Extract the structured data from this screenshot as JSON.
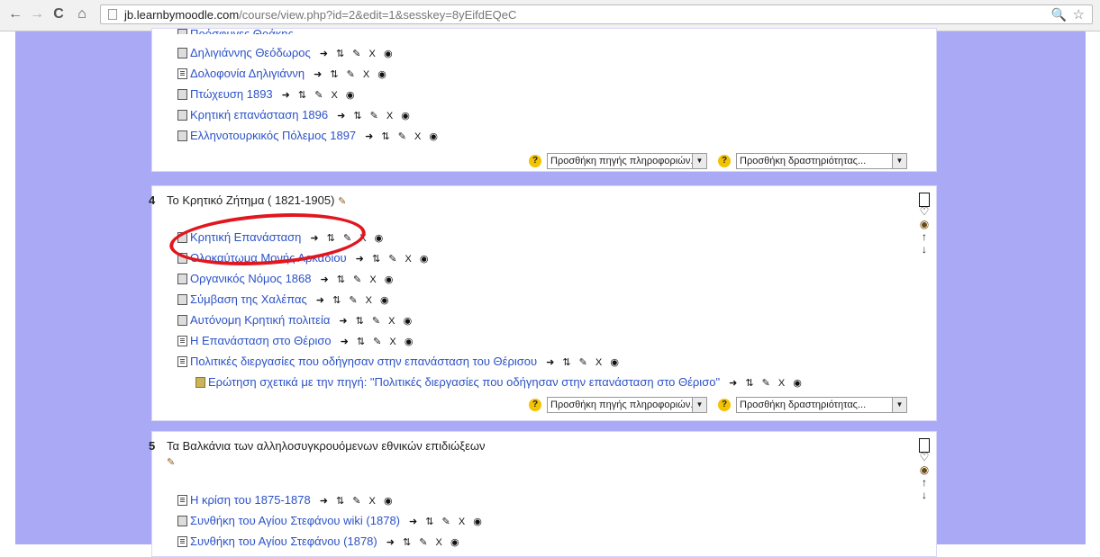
{
  "browser": {
    "back": "←",
    "forward": "→",
    "reload": "C",
    "home": "⌂",
    "url_host": "jb.learnbymoodle.com",
    "url_path": "/course/view.php?id=2&edit=1&sesskey=8yEifdEQeC",
    "zoom": "🔍",
    "star": "☆"
  },
  "sections": [
    {
      "number": "",
      "title": "",
      "items": [
        {
          "label": "Δηλιγιάννης Θεόδωρος",
          "type": "link"
        },
        {
          "label": "Δολοφονία Δηλιγιάννη",
          "type": "res"
        },
        {
          "label": "Πτώχευση 1893",
          "type": "link"
        },
        {
          "label": "Κρητική επανάσταση 1896",
          "type": "link"
        },
        {
          "label": "Ελληνοτουρκικός Πόλεμος 1897",
          "type": "link"
        }
      ],
      "add_resource": "Προσθήκη πηγής πληροφοριών...",
      "add_activity": "Προσθήκη δραστηριότητας..."
    },
    {
      "number": "4",
      "title": "Το Κρητικό Ζήτημα ( 1821-1905)",
      "items": [
        {
          "label": "Κρητική Επανάσταση",
          "type": "link"
        },
        {
          "label": "Ολοκαύτωμα Μονής Αρκαδίου",
          "type": "link"
        },
        {
          "label": "Οργανικός Νόμος 1868",
          "type": "link"
        },
        {
          "label": "Σύμβαση της Χαλέπας",
          "type": "link"
        },
        {
          "label": "Αυτόνομη Κρητική πολιτεία",
          "type": "link"
        },
        {
          "label": "Η Επανάσταση στο Θέρισο",
          "type": "res"
        },
        {
          "label": "Πολιτικές διεργασίες που οδήγησαν στην επανάσταση του Θέρισου",
          "type": "res"
        },
        {
          "label": "Ερώτηση σχετικά με την πηγή: \"Πολιτικές διεργασίες που οδήγησαν στην επανάσταση στο Θέρισο\"",
          "type": "quiz"
        }
      ],
      "add_resource": "Προσθήκη πηγής πληροφοριών...",
      "add_activity": "Προσθήκη δραστηριότητας..."
    },
    {
      "number": "5",
      "title": "Τα Βαλκάνια των αλληλοσυγκρουόμενων εθνικών επιδιώξεων",
      "items": [
        {
          "label": "Η κρίση του 1875-1878",
          "type": "res"
        },
        {
          "label": "Συνθήκη του Αγίου Στεφάνου wiki (1878)",
          "type": "link"
        },
        {
          "label": "Συνθήκη του Αγίου Στεφάνου (1878)",
          "type": "res"
        }
      ]
    }
  ],
  "actions_text": "➜ ⇅ ✎ X ◉",
  "help_glyph": "?",
  "side_icons": {
    "lightbulb": "♡",
    "eye": "◉",
    "up": "↑",
    "down": "↓"
  }
}
